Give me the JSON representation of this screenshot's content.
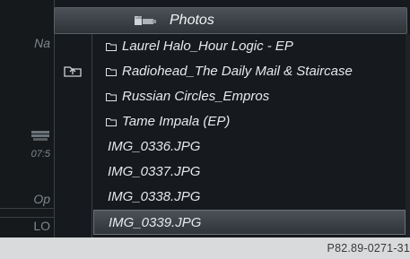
{
  "header": {
    "title": "Photos",
    "source_icon": "usb-icon"
  },
  "left_panel": {
    "items": [
      {
        "text": "Na"
      },
      {
        "text": "07:5"
      },
      {
        "text": "Op"
      },
      {
        "text": "LO"
      }
    ],
    "device_icon": "car-icon"
  },
  "back_icon": "folder-up-icon",
  "folders": [
    {
      "name": "Laurel Halo_Hour Logic - EP"
    },
    {
      "name": "Radiohead_The Daily Mail & Staircase"
    },
    {
      "name": "Russian Circles_Empros"
    },
    {
      "name": "Tame Impala (EP)"
    }
  ],
  "files": [
    {
      "name": "IMG_0336.JPG"
    },
    {
      "name": "IMG_0337.JPG"
    },
    {
      "name": "IMG_0338.JPG"
    },
    {
      "name": "IMG_0339.JPG",
      "selected": true
    }
  ],
  "footer": {
    "code": "P82.89-0271-31"
  },
  "colors": {
    "screen_bg": "#161a1e",
    "highlight": "#4b5157",
    "text": "#e6e9ec",
    "footer_bg": "#d9dadc"
  }
}
